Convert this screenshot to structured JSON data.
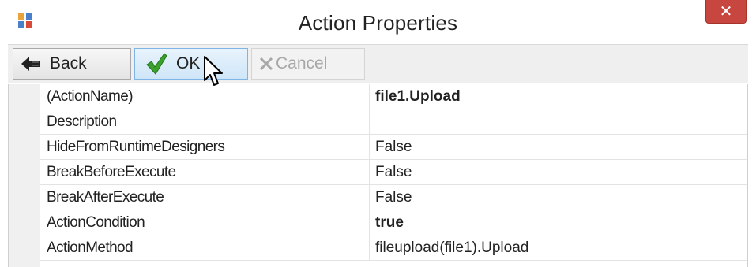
{
  "window": {
    "title": "Action Properties",
    "close_glyph": "✕"
  },
  "toolbar": {
    "back_label": "Back",
    "ok_label": "OK",
    "cancel_label": "Cancel"
  },
  "properties": [
    {
      "name": "(ActionName)",
      "value": "file1.Upload",
      "bold": true
    },
    {
      "name": "Description",
      "value": "",
      "bold": false
    },
    {
      "name": "HideFromRuntimeDesigners",
      "value": "False",
      "bold": false
    },
    {
      "name": "BreakBeforeExecute",
      "value": "False",
      "bold": false
    },
    {
      "name": "BreakAfterExecute",
      "value": "False",
      "bold": false
    },
    {
      "name": "ActionCondition",
      "value": "true",
      "bold": true
    },
    {
      "name": "ActionMethod",
      "value": "fileupload(file1).Upload",
      "bold": false
    }
  ],
  "colors": {
    "close": "#c7463f",
    "ok_highlight": "#cfe6f8",
    "checkmark": "#3aa12b"
  },
  "icons": [
    "app-icon",
    "close-icon",
    "back-arrow-icon",
    "checkmark-icon",
    "cancel-x-icon",
    "mouse-cursor-icon"
  ]
}
